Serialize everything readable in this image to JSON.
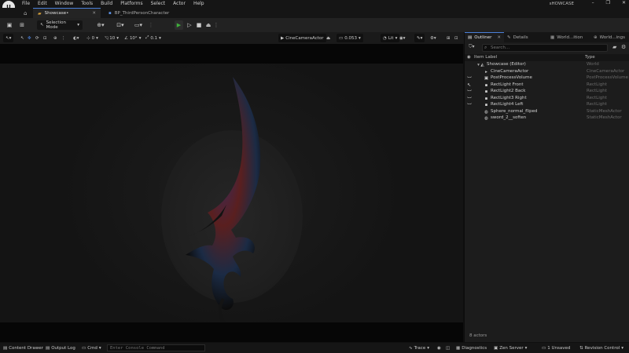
{
  "menubar": {
    "logo": "U",
    "items": [
      "File",
      "Edit",
      "Window",
      "Tools",
      "Build",
      "Platforms",
      "Select",
      "Actor",
      "Help"
    ],
    "project_name": "sHOWCASE",
    "window_controls": [
      "–",
      "❐",
      "✕"
    ]
  },
  "tabs": [
    {
      "label": "Showcase•"
    },
    {
      "label": "BP_ThirdPersonCharacter"
    }
  ],
  "toolbar": {
    "mode": "Selection Mode"
  },
  "viewport_toolbar": {
    "grid_snap": "0",
    "rotation_snap": "10",
    "scale_angle": "10°",
    "scale_snap": "0.1",
    "camera_actor": "CineCameraActor",
    "camera_speed": "0.053",
    "view_mode": "Lit"
  },
  "outliner": {
    "tabs": [
      {
        "label": "Outliner"
      },
      {
        "label": "Details"
      },
      {
        "label": "World...ition"
      },
      {
        "label": "World...ings"
      }
    ],
    "search_placeholder": "Search...",
    "col_label": "Item Label",
    "col_type": "Type",
    "rows": [
      {
        "label": "Showcase (Editor)",
        "type": "World"
      },
      {
        "label": "CineCameraActor",
        "type": "CineCameraActor"
      },
      {
        "label": "PostProcessVolume",
        "type": "PostProcessVolume"
      },
      {
        "label": "RectLight Front",
        "type": "RectLight"
      },
      {
        "label": "RectLight2 Back",
        "type": "RectLight"
      },
      {
        "label": "RectLight3 Right",
        "type": "RectLight"
      },
      {
        "label": "RectLight4 Left",
        "type": "RectLight"
      },
      {
        "label": "Sphere_normal_fliped",
        "type": "StaticMeshActor"
      },
      {
        "label": "sword_2__soften",
        "type": "StaticMeshActor"
      }
    ],
    "footer": "8 actors"
  },
  "statusbar": {
    "content_drawer": "Content Drawer",
    "output_log": "Output Log",
    "cmd": "Cmd",
    "console_placeholder": "Enter Console Command",
    "trace": "Trace",
    "diagnostics": "Diagnostics",
    "zen_server": "Zen Server",
    "unsaved": "1 Unsaved",
    "revision_control": "Revision Control"
  },
  "colors": {
    "accent": "#4a7fd9",
    "play_green": "#3fae3b",
    "folder": "#d9a33b"
  }
}
